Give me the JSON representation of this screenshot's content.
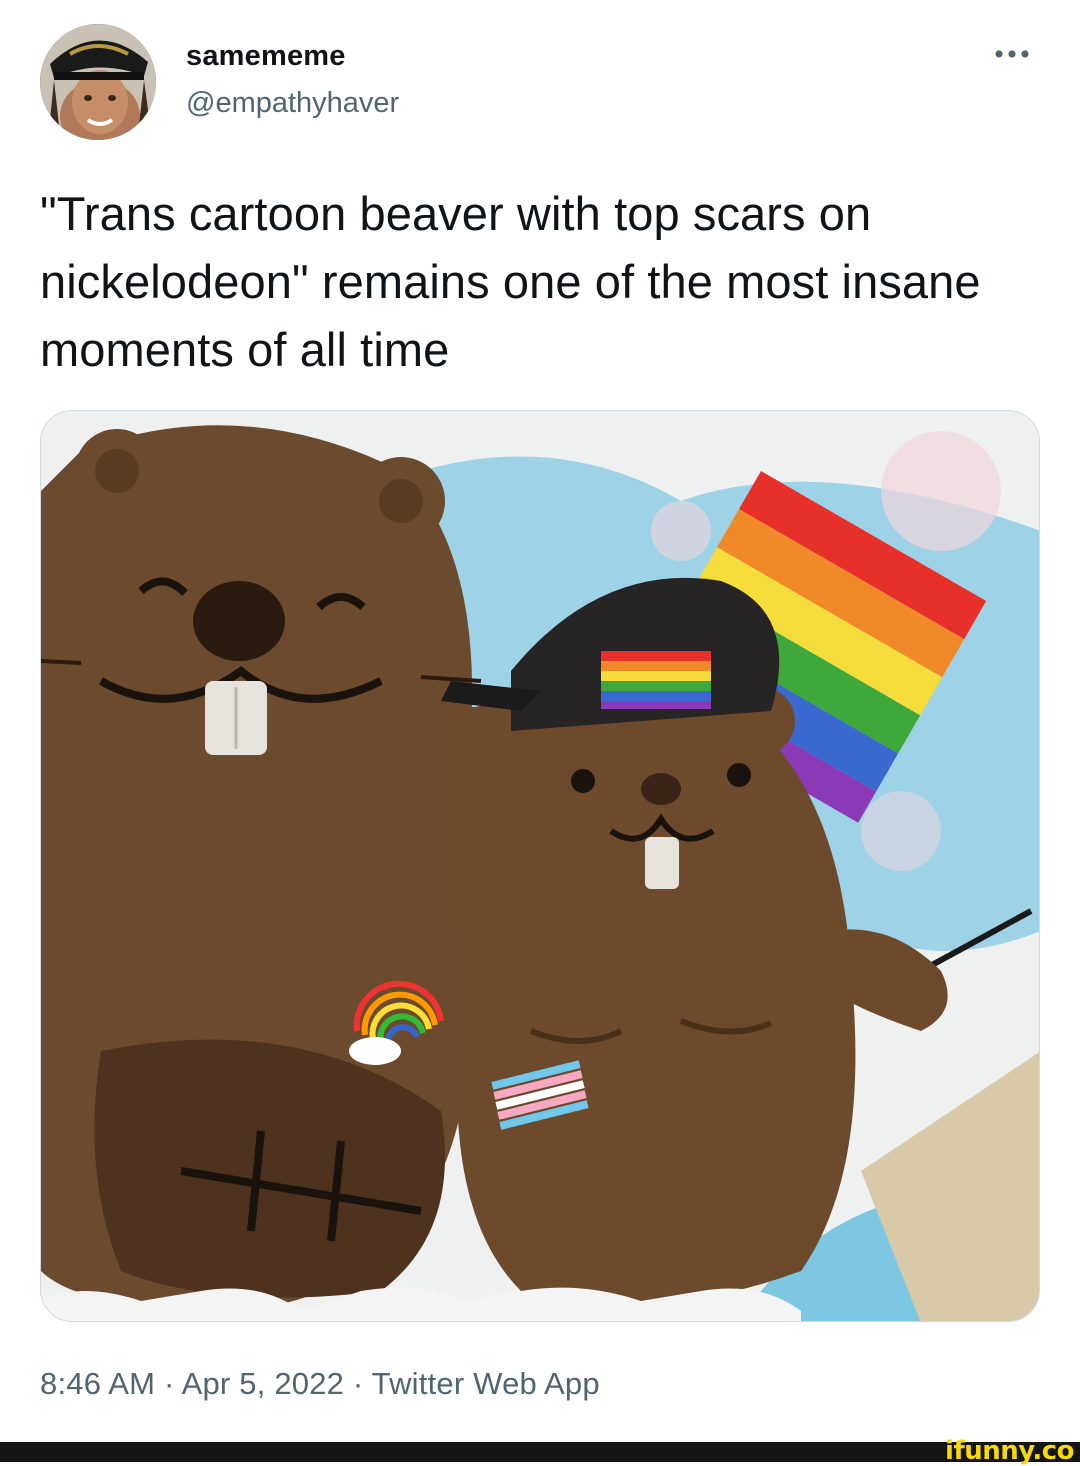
{
  "tweet": {
    "display_name": "samememe",
    "handle": "@empathyhaver",
    "more_icon": "more-horizontal-icon",
    "text": "\"Trans cartoon beaver with top scars on nickelodeon\" remains one of the most insane moments of all time",
    "timestamp": {
      "time": "8:46 AM",
      "sep1": " · ",
      "date": "Apr 5, 2022",
      "sep2": " · ",
      "source": "Twitter Web App"
    }
  },
  "watermark": "ifunny.co",
  "colors": {
    "text_primary": "#0f1419",
    "text_secondary": "#536471",
    "border": "#cfd9de",
    "beaver_brown": "#6b4a2e",
    "watermark_yellow": "#f5d90a"
  }
}
